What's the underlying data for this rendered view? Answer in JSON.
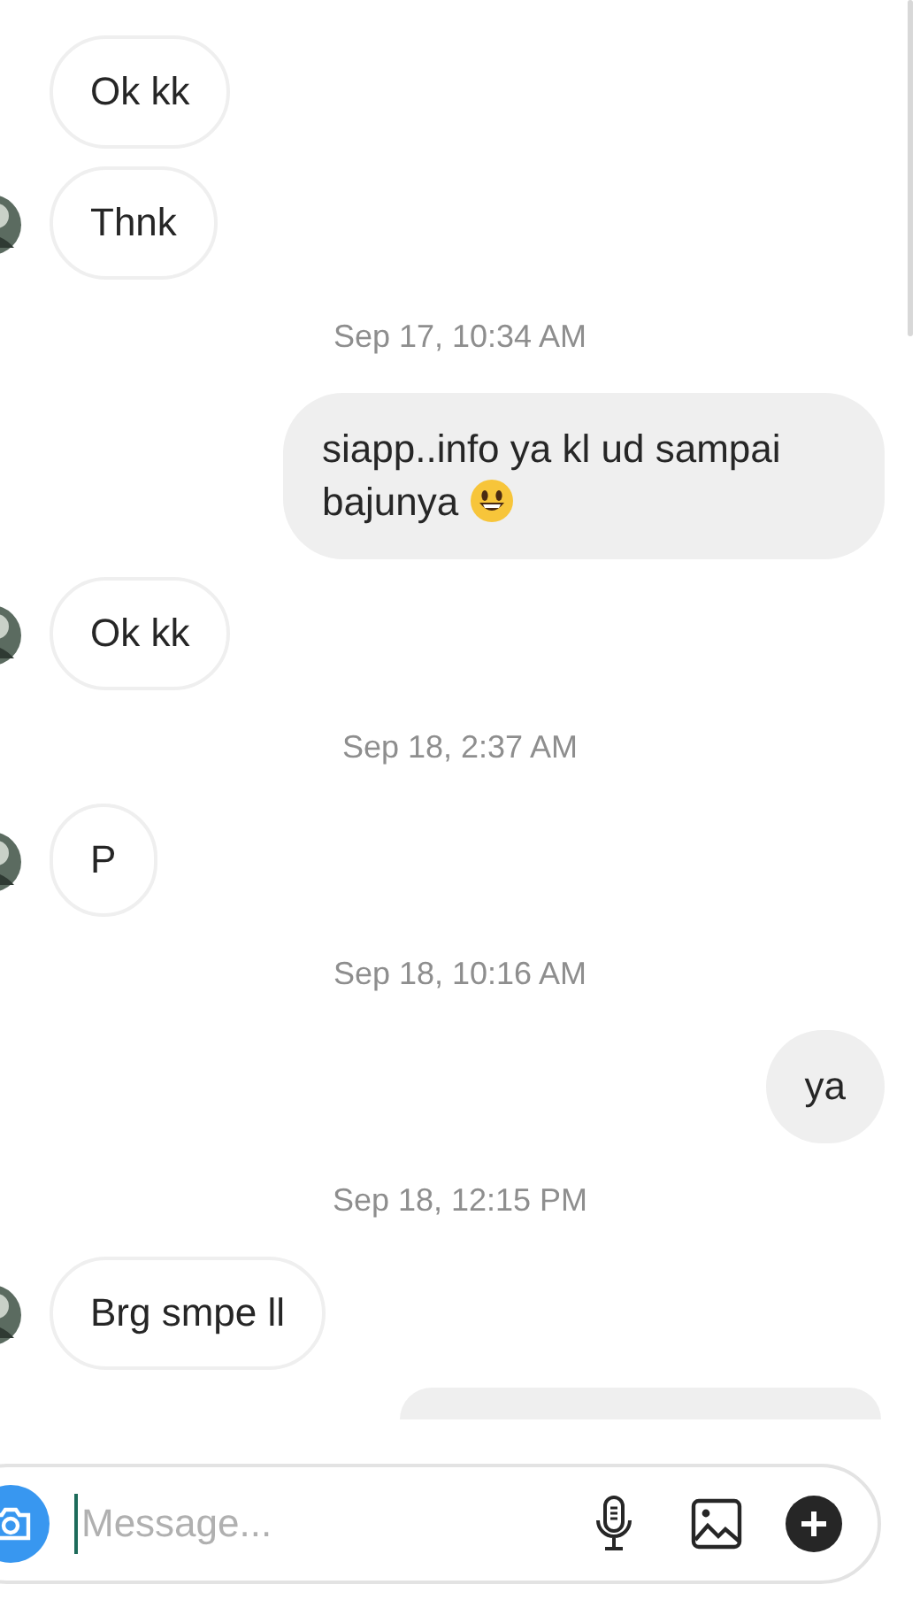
{
  "messages": [
    {
      "kind": "received",
      "text": "Ok kk",
      "avatar": false
    },
    {
      "kind": "received",
      "text": "Thnk",
      "avatar": true
    },
    {
      "kind": "timestamp",
      "text": "Sep 17, 10:34 AM"
    },
    {
      "kind": "sent",
      "text": "siapp..info ya kl ud sampai bajunya",
      "emoji": true
    },
    {
      "kind": "received",
      "text": "Ok kk",
      "avatar": true
    },
    {
      "kind": "timestamp",
      "text": "Sep 18, 2:37 AM"
    },
    {
      "kind": "received",
      "text": "P",
      "avatar": true
    },
    {
      "kind": "timestamp",
      "text": "Sep 18, 10:16 AM"
    },
    {
      "kind": "sent",
      "text": "ya",
      "emoji": false
    },
    {
      "kind": "timestamp",
      "text": "Sep 18, 12:15 PM"
    },
    {
      "kind": "received",
      "text": "Brg smpe ll",
      "avatar": true
    },
    {
      "kind": "sent_partial"
    }
  ],
  "composer": {
    "placeholder": "Message..."
  }
}
